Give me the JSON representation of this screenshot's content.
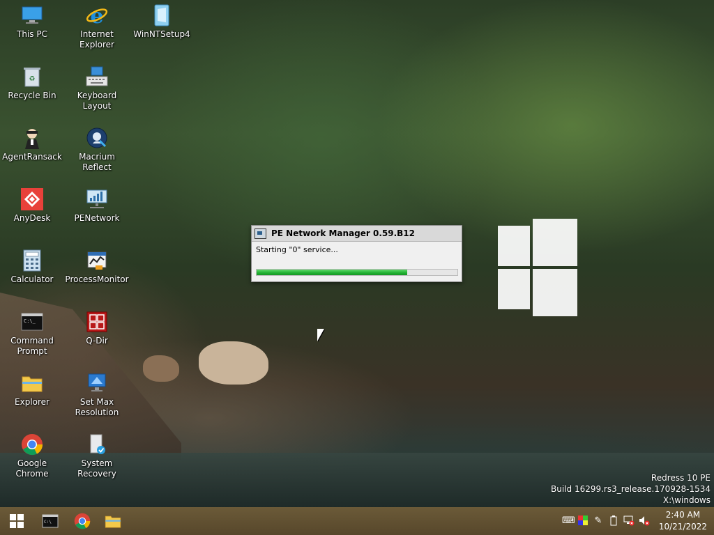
{
  "desktop_icons": [
    {
      "label": "This PC",
      "icon": "computer-icon"
    },
    {
      "label": "Internet Explorer",
      "icon": "internet-explorer-icon"
    },
    {
      "label": "WinNTSetup4",
      "icon": "winntsetup-icon"
    },
    {
      "label": "Recycle Bin",
      "icon": "recycle-bin-icon"
    },
    {
      "label": "Keyboard Layout",
      "icon": "keyboard-icon"
    },
    {
      "label": "AgentRansack",
      "icon": "agent-ransack-icon"
    },
    {
      "label": "Macrium Reflect",
      "icon": "macrium-reflect-icon"
    },
    {
      "label": "AnyDesk",
      "icon": "anydesk-icon"
    },
    {
      "label": "PENetwork",
      "icon": "penetwork-icon"
    },
    {
      "label": "Calculator",
      "icon": "calculator-icon"
    },
    {
      "label": "ProcessMonitor",
      "icon": "process-monitor-icon"
    },
    {
      "label": "Command Prompt",
      "icon": "command-prompt-icon"
    },
    {
      "label": "Q-Dir",
      "icon": "qdir-icon"
    },
    {
      "label": "Explorer",
      "icon": "folder-icon"
    },
    {
      "label": "Set Max Resolution",
      "icon": "display-icon"
    },
    {
      "label": "Google Chrome",
      "icon": "chrome-icon"
    },
    {
      "label": "System Recovery",
      "icon": "system-recovery-icon"
    }
  ],
  "dialog": {
    "title": "PE Network Manager 0.59.B12",
    "status": "Starting \"0\" service...",
    "progress": 0.75,
    "progress_color": "#20b030"
  },
  "system_info": {
    "line1": "Redress 10 PE",
    "line2": "Build 16299.rs3_release.170928-1534",
    "line3": "X:\\windows"
  },
  "taskbar": {
    "pinned": [
      "start-icon",
      "command-prompt-icon",
      "chrome-icon",
      "folder-icon"
    ],
    "tray_icons": [
      "keyboard-icon",
      "color-icon",
      "pen-icon",
      "battery-icon",
      "network-disconnected-icon",
      "volume-muted-icon"
    ],
    "time": "2:40 AM",
    "date": "10/21/2022",
    "background": "#5a4a2e"
  }
}
